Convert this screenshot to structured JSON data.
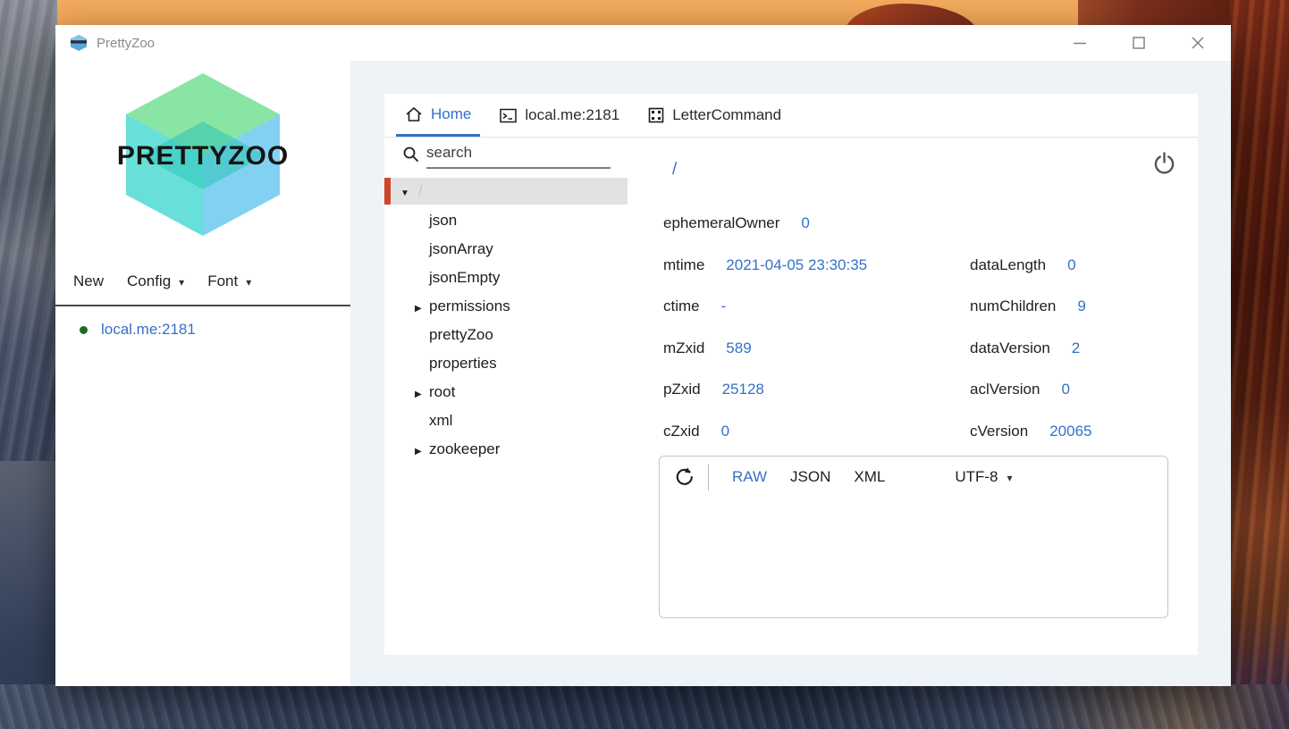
{
  "colors": {
    "accent_blue": "#3470c8",
    "selection_red": "#cf4527",
    "status_green": "#1d6b20",
    "title_gray": "#8b8b8b",
    "main_bg": "#eef3f8"
  },
  "window": {
    "title": "PrettyZoo",
    "controls": [
      "minimize",
      "maximize",
      "close"
    ]
  },
  "sidebar": {
    "logo_text": "PRETTYZOO",
    "menus": [
      {
        "label": "New",
        "has_caret": false
      },
      {
        "label": "Config",
        "has_caret": true
      },
      {
        "label": "Font",
        "has_caret": true
      }
    ],
    "server": {
      "label": "local.me:2181",
      "status": "connected"
    }
  },
  "tabs": [
    {
      "label": "Home",
      "icon": "home-icon",
      "active": true
    },
    {
      "label": "local.me:2181",
      "icon": "terminal-icon",
      "active": false
    },
    {
      "label": "LetterCommand",
      "icon": "command-icon",
      "active": false
    }
  ],
  "tree": {
    "search_placeholder": "search",
    "selected": {
      "label": "/",
      "expanded": true
    },
    "items": [
      {
        "label": "json",
        "expandable": false
      },
      {
        "label": "jsonArray",
        "expandable": false
      },
      {
        "label": "jsonEmpty",
        "expandable": false
      },
      {
        "label": "permissions",
        "expandable": true
      },
      {
        "label": "prettyZoo",
        "expandable": false
      },
      {
        "label": "properties",
        "expandable": false
      },
      {
        "label": "root",
        "expandable": true
      },
      {
        "label": "xml",
        "expandable": false
      },
      {
        "label": "zookeeper",
        "expandable": true
      }
    ]
  },
  "detail": {
    "path": "/",
    "stats_left": [
      {
        "label": "ephemeralOwner",
        "value": "0"
      },
      {
        "label": "mtime",
        "value": "2021-04-05 23:30:35"
      },
      {
        "label": "ctime",
        "value": "-"
      },
      {
        "label": "mZxid",
        "value": "589"
      },
      {
        "label": "pZxid",
        "value": "25128"
      },
      {
        "label": "cZxid",
        "value": "0"
      }
    ],
    "stats_right": [
      {
        "label": "",
        "value": ""
      },
      {
        "label": "dataLength",
        "value": "0"
      },
      {
        "label": "numChildren",
        "value": "9"
      },
      {
        "label": "dataVersion",
        "value": "2"
      },
      {
        "label": "aclVersion",
        "value": "0"
      },
      {
        "label": "cVersion",
        "value": "20065"
      }
    ]
  },
  "data_panel": {
    "modes": [
      {
        "label": "RAW",
        "active": true
      },
      {
        "label": "JSON",
        "active": false
      },
      {
        "label": "XML",
        "active": false
      }
    ],
    "encoding": "UTF-8",
    "content": ""
  },
  "icons": {
    "app-icon": "prettyzoo hexagon glyph",
    "home-icon": "house outline",
    "terminal-icon": "prompt box >_",
    "command-icon": "dotted square",
    "search-icon": "magnifier",
    "power-icon": "power symbol",
    "refresh-icon": "circular arrow",
    "caret-down-icon": "▼",
    "caret-right-icon": "▶",
    "dropdown-caret-icon": "▾"
  }
}
